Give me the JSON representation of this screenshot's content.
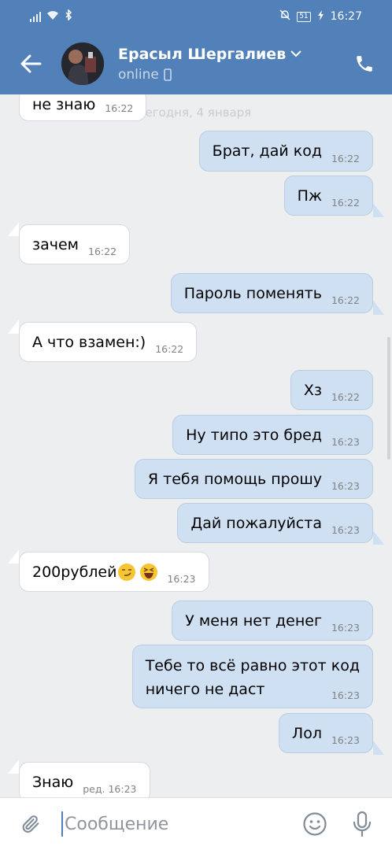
{
  "status_bar": {
    "battery": "51",
    "time": "16:27"
  },
  "header": {
    "name": "Ерасыл Шергалиев",
    "presence": "online"
  },
  "chat": {
    "date_separator": "Сегодня, 4 января",
    "messages": [
      {
        "side": "in",
        "text": "не знаю",
        "time": "16:22"
      },
      {
        "side": "out",
        "text": "Брат, дай код",
        "time": "16:22"
      },
      {
        "side": "out",
        "text": "Пж",
        "time": "16:22"
      },
      {
        "side": "in",
        "text": "зачем",
        "time": "16:22"
      },
      {
        "side": "out",
        "text": "Пароль поменять",
        "time": "16:22"
      },
      {
        "side": "in",
        "text": "А что взамен:)",
        "time": "16:22"
      },
      {
        "side": "out",
        "text": "Хз",
        "time": "16:22"
      },
      {
        "side": "out",
        "text": "Ну типо это бред",
        "time": "16:23"
      },
      {
        "side": "out",
        "text": "Я тебя помощь прошу",
        "time": "16:23"
      },
      {
        "side": "out",
        "text": "Дай пожалуйста",
        "time": "16:23"
      },
      {
        "side": "in",
        "text": "200рублей",
        "emojis": [
          "smirking-face",
          "grinning-squinting-face"
        ],
        "time": "16:23"
      },
      {
        "side": "out",
        "text": "У меня нет денег",
        "time": "16:23"
      },
      {
        "side": "out",
        "text_lines": [
          "Тебе то всё равно этот код",
          "ничего не даст"
        ],
        "time": "16:23"
      },
      {
        "side": "out",
        "text": "Лол",
        "time": "16:23"
      },
      {
        "side": "in",
        "text": "Знаю",
        "time": "ред. 16:23"
      }
    ]
  },
  "input": {
    "placeholder": "Сообщение"
  },
  "colors": {
    "header": "#5181b8",
    "chat_background": "#edeef0",
    "incoming_bubble": "#ffffff",
    "outgoing_bubble": "#cfe0f3"
  },
  "icons": [
    "back-arrow-icon",
    "chevron-down-icon",
    "phone-icon",
    "mobile-device-icon",
    "paperclip-icon",
    "emoji-icon",
    "microphone-icon",
    "signal-icon",
    "wifi-icon",
    "bluetooth-icon",
    "mute-icon",
    "battery-icon",
    "charging-icon"
  ]
}
